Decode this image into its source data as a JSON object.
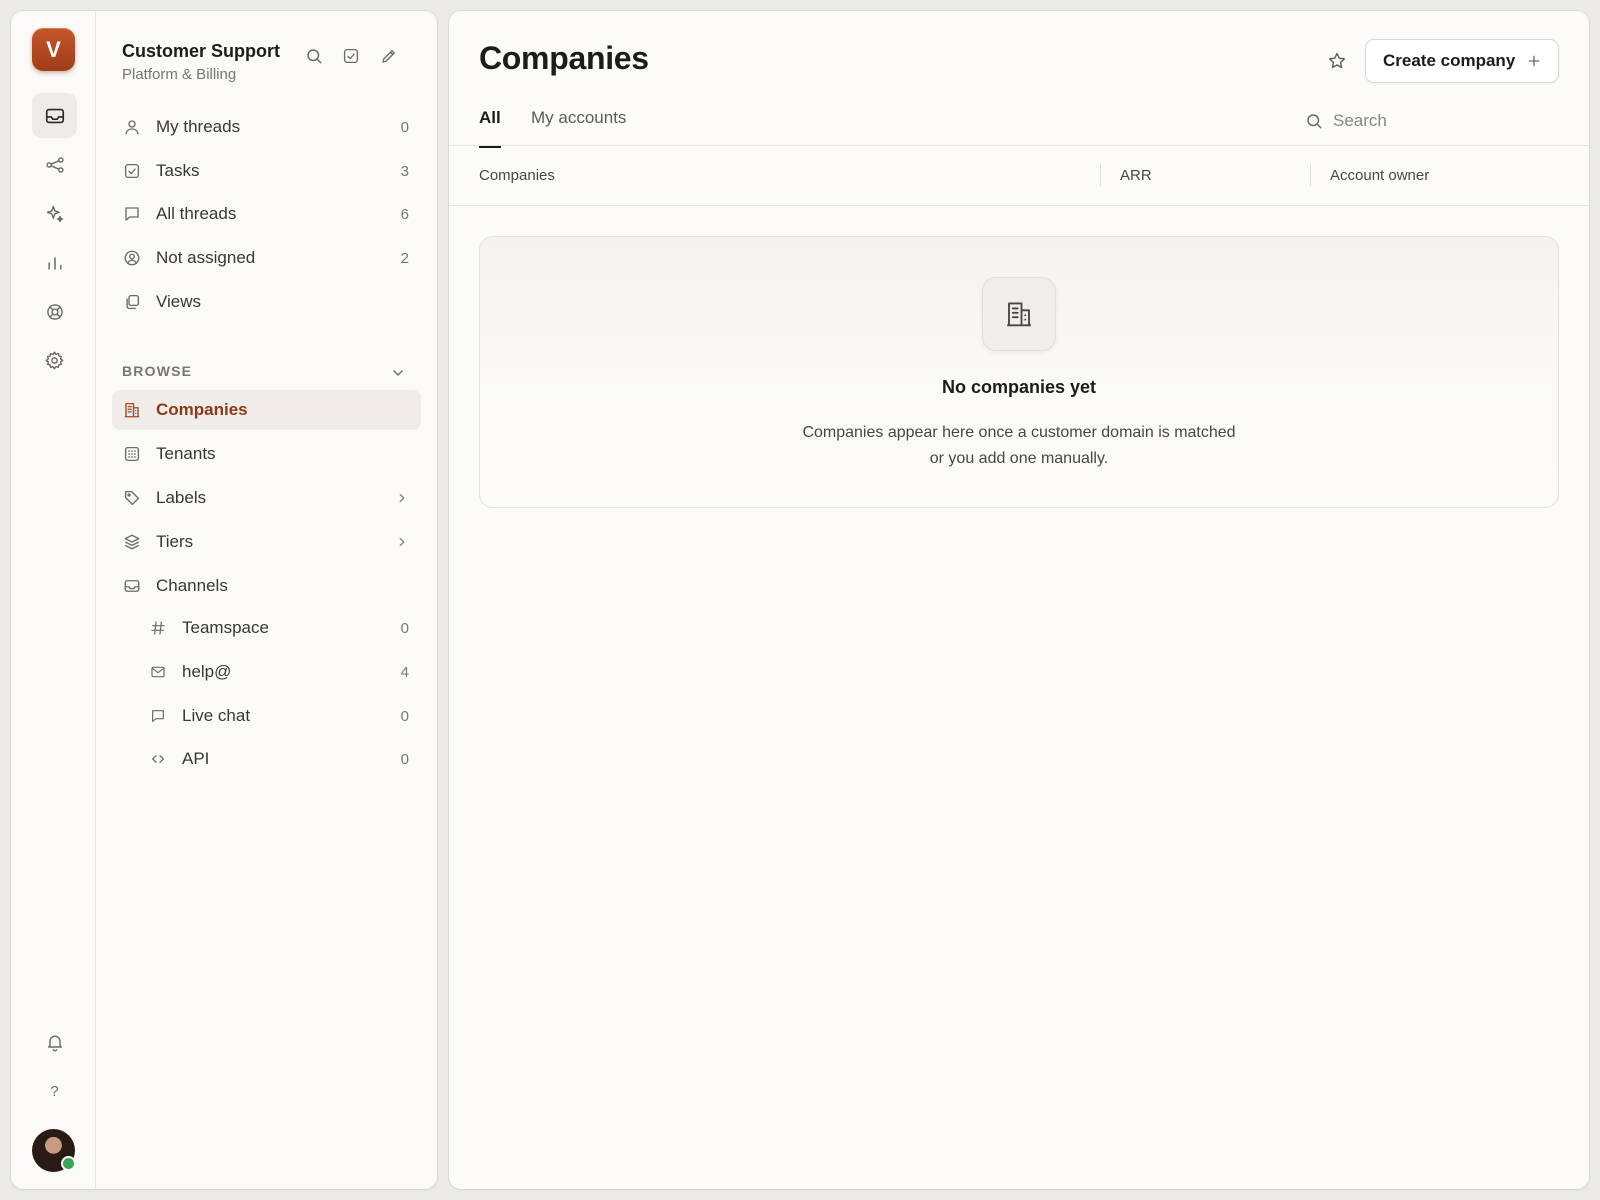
{
  "brand": {
    "initial": "V"
  },
  "workspace": {
    "name": "Customer Support",
    "subtitle": "Platform & Billing"
  },
  "nav": [
    {
      "label": "My threads",
      "count": "0",
      "icon": "user-icon"
    },
    {
      "label": "Tasks",
      "count": "3",
      "icon": "checkbox-icon"
    },
    {
      "label": "All threads",
      "count": "6",
      "icon": "chat-bubble-icon"
    },
    {
      "label": "Not assigned",
      "count": "2",
      "icon": "user-circle-icon"
    },
    {
      "label": "Views",
      "count": "",
      "icon": "copy-icon"
    }
  ],
  "browse": {
    "label": "BROWSE",
    "items": [
      {
        "label": "Companies",
        "icon": "building-icon",
        "active": true
      },
      {
        "label": "Tenants",
        "icon": "grid-icon"
      },
      {
        "label": "Labels",
        "icon": "tag-icon",
        "chevron": true
      },
      {
        "label": "Tiers",
        "icon": "layers-icon",
        "chevron": true
      },
      {
        "label": "Channels",
        "icon": "inbox-icon"
      }
    ],
    "channels": [
      {
        "label": "Teamspace",
        "count": "0",
        "icon": "hash-icon"
      },
      {
        "label": "help@",
        "count": "4",
        "icon": "mail-icon"
      },
      {
        "label": "Live chat",
        "count": "0",
        "icon": "chat-bubble-icon"
      },
      {
        "label": "API",
        "count": "0",
        "icon": "code-icon"
      }
    ]
  },
  "rail": {
    "help_label": "?"
  },
  "main": {
    "title": "Companies",
    "create_button": "Create company",
    "tabs": [
      {
        "label": "All",
        "active": true
      },
      {
        "label": "My accounts"
      }
    ],
    "search_placeholder": "Search",
    "columns": [
      "Companies",
      "ARR",
      "Account owner"
    ],
    "empty": {
      "title": "No companies yet",
      "line1": "Companies appear here once a customer domain is matched",
      "line2": "or you add one manually."
    }
  }
}
